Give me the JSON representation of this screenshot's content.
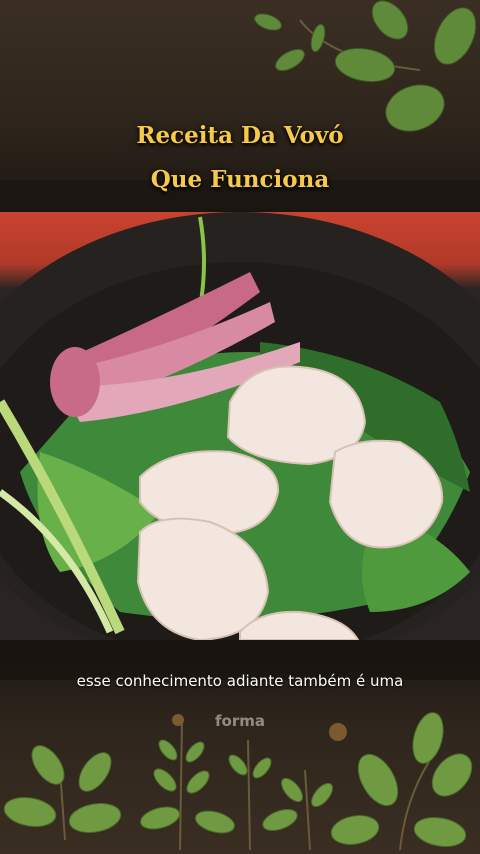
{
  "title": {
    "line1": "Receita Da Vovó",
    "line2": "Que Funciona"
  },
  "caption": {
    "line1": "esse conhecimento adiante também é uma",
    "line2": "forma"
  },
  "colors": {
    "title": "#f6c94a",
    "caption": "#ffffff",
    "background": "#2a2118",
    "bowl": "#262321",
    "garlic": "#f3e6de"
  }
}
